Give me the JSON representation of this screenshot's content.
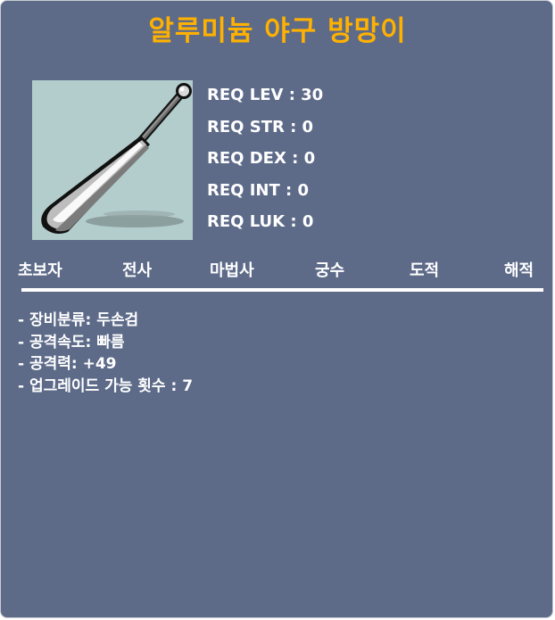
{
  "item": {
    "name": "알루미늄 야구 방망이",
    "icon": "aluminum-baseball-bat"
  },
  "requirements": [
    "REQ LEV : 30",
    "REQ STR : 0",
    "REQ DEX : 0",
    "REQ INT : 0",
    "REQ LUK : 0"
  ],
  "jobs": [
    "초보자",
    "전사",
    "마법사",
    "궁수",
    "도적",
    "해적"
  ],
  "info": [
    "- 장비분류: 두손검",
    "- 공격속도: 빠름",
    "- 공격력: +49",
    "- 업그레이드 가능 횟수 : 7"
  ],
  "colors": {
    "panel": "#5d6b89",
    "title": "#ffb100",
    "text": "#ffffff",
    "item_bg": "#b3cdcd"
  }
}
